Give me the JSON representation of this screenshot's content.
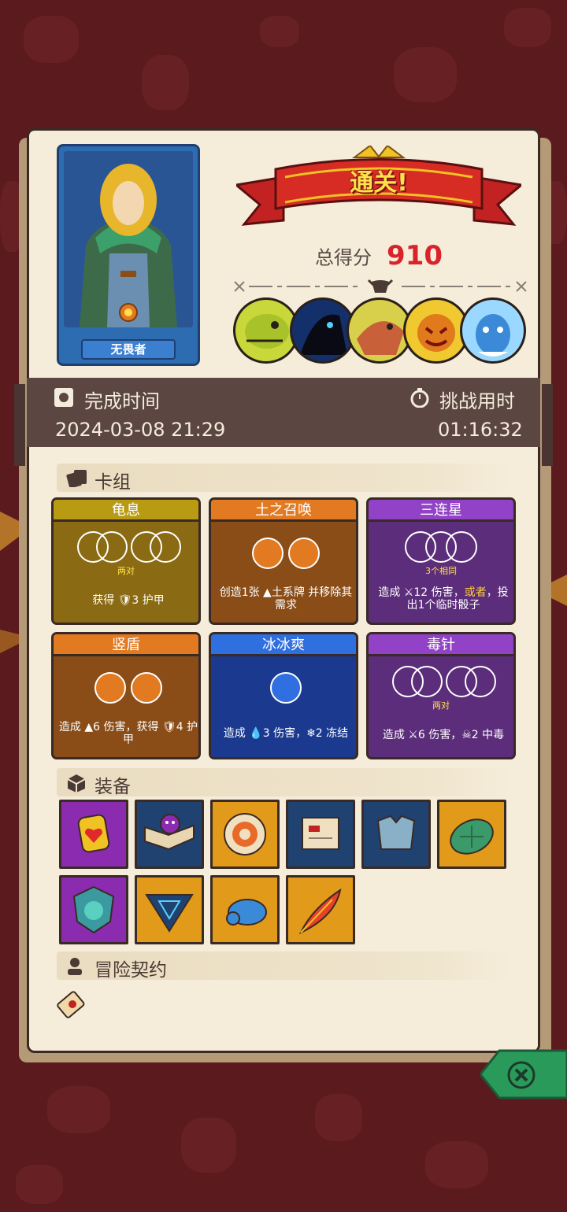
{
  "hero": {
    "name": "无畏者"
  },
  "result": {
    "banner": "通关!",
    "score_label": "总得分",
    "score_value": "910"
  },
  "bosses": [
    "boss-lizard-icon",
    "boss-shadow-icon",
    "boss-fish-icon",
    "boss-pumpkin-icon",
    "boss-ice-dragon-icon"
  ],
  "time": {
    "finish_label": "完成时间",
    "finish_value": "2024-03-08 21:29",
    "duration_label": "挑战用时",
    "duration_value": "01:16:32"
  },
  "deck": {
    "title": "卡组",
    "cards": [
      {
        "name": "龟息",
        "sub": "两对",
        "desc": "获得 🛡3 护甲",
        "color": "#b99b13"
      },
      {
        "name": "土之召唤",
        "sub": "",
        "desc": "创造1张 ▲土系牌 并移除其需求",
        "color": "#e27a22"
      },
      {
        "name": "三连星",
        "sub": "3个相同",
        "desc_pre": "造成 ⚔12 伤害，",
        "desc_hl": "或者",
        "desc_post": "，投出1个临时骰子",
        "color": "#9242c7"
      },
      {
        "name": "竖盾",
        "sub": "",
        "desc": "造成 ▲6 伤害，获得 🛡4 护甲",
        "color": "#e27a22"
      },
      {
        "name": "冰冰爽",
        "sub": "",
        "desc": "造成 💧3 伤害，❄2 冻结",
        "color": "#2f6fe0"
      },
      {
        "name": "毒针",
        "sub": "两对",
        "desc": "造成 ⚔6 伤害，☠2 中毒",
        "color": "#9242c7"
      }
    ]
  },
  "equipment": {
    "title": "装备",
    "items": [
      "heart-shield-icon",
      "skull-book-icon",
      "orange-medallion-icon",
      "scroll-icon",
      "steel-armor-icon",
      "turtle-shell-icon",
      "lion-emblem-icon",
      "triangle-rune-icon",
      "blue-slime-icon",
      "phoenix-feather-icon"
    ]
  },
  "contract": {
    "title": "冒险契约",
    "items": [
      "scroll-contract-icon"
    ]
  },
  "colors": {
    "score": "#d8232a",
    "background": "#5a1a1e",
    "paper": "#f5ecd9"
  }
}
